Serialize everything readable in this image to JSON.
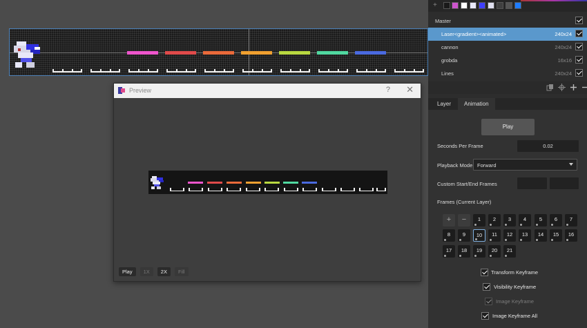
{
  "colors": {
    "selection": "#5a98cc",
    "swatches": [
      "#1a1a1a",
      "#cc55cc",
      "#ffffff",
      "#e8e8f8",
      "#4040ff",
      "#e0e0f0",
      "#404040",
      "#555555",
      "#1e7cff"
    ],
    "lasers": [
      "#ee55cc",
      "#e04a4a",
      "#ea6a3a",
      "#f0a030",
      "#b8d840",
      "#50d8a0",
      "#4a6ae0"
    ]
  },
  "toolbar": {
    "add_icon": "+"
  },
  "layers": [
    {
      "name": "Master",
      "size": "",
      "checked": true,
      "selected": false,
      "indent": false
    },
    {
      "name": "Laser<gradient><animated>",
      "size": "240x24",
      "checked": true,
      "selected": true,
      "indent": true
    },
    {
      "name": "cannon",
      "size": "240x24",
      "checked": true,
      "selected": false,
      "indent": true
    },
    {
      "name": "grobda",
      "size": "16x16",
      "checked": true,
      "selected": false,
      "indent": true
    },
    {
      "name": "Lines",
      "size": "240x24",
      "checked": true,
      "selected": false,
      "indent": true
    }
  ],
  "layer_tools": [
    "copy-icon",
    "move-icon",
    "add-icon",
    "remove-icon"
  ],
  "tabs": [
    "Layer",
    "Animation"
  ],
  "animation": {
    "play_label": "Play",
    "spf_label": "Seconds Per Frame",
    "spf_value": "0.02",
    "playback_label": "Playback Mode",
    "playback_value": "Forward",
    "custom_label": "Custom Start/End Frames",
    "start_value": "",
    "end_value": "",
    "frames_label": "Frames (Current Layer)",
    "add_frame": "+",
    "remove_frame": "−",
    "frames": [
      "1",
      "2",
      "3",
      "4",
      "5",
      "6",
      "7",
      "8",
      "9",
      "10",
      "11",
      "12",
      "13",
      "14",
      "15",
      "16",
      "17",
      "18",
      "19",
      "20",
      "21"
    ],
    "current_frame": "10",
    "keyframes": [
      {
        "label": "Transform Keyframe",
        "checked": true,
        "dim": false
      },
      {
        "label": "Visibility Keyframe",
        "checked": true,
        "dim": false
      },
      {
        "label": "Image Keyframe",
        "checked": true,
        "dim": true
      },
      {
        "label": "Image Keyframe All",
        "checked": true,
        "dim": false
      }
    ]
  },
  "preview": {
    "title": "Preview",
    "help": "?",
    "close": "✕",
    "buttons": [
      {
        "label": "Play",
        "dim": false
      },
      {
        "label": "1X",
        "dim": true
      },
      {
        "label": "2X",
        "dim": false
      },
      {
        "label": "Fill",
        "dim": true
      }
    ]
  }
}
